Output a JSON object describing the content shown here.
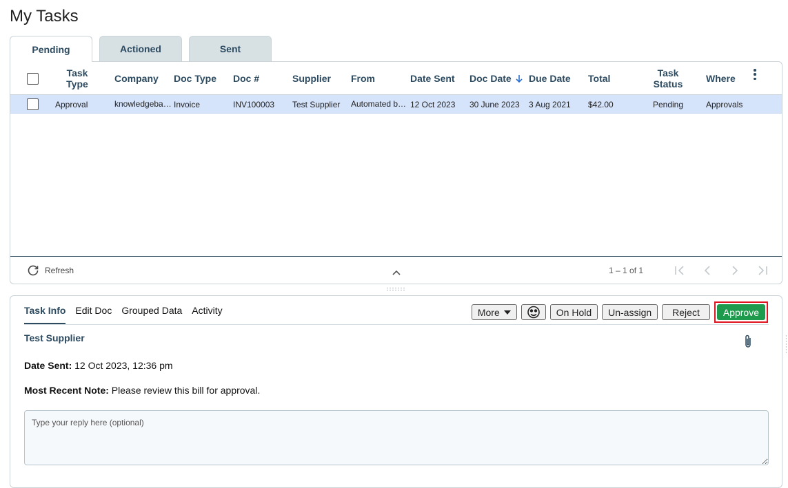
{
  "page": {
    "title": "My Tasks"
  },
  "tabs": [
    {
      "label": "Pending",
      "active": true
    },
    {
      "label": "Actioned",
      "active": false
    },
    {
      "label": "Sent",
      "active": false
    }
  ],
  "grid": {
    "columns": [
      "Task Type",
      "Company",
      "Doc Type",
      "Doc #",
      "Supplier",
      "From",
      "Date Sent",
      "Doc Date",
      "Due Date",
      "Total",
      "Task Status",
      "Where"
    ],
    "sort": {
      "column": "Doc Date",
      "direction": "desc"
    },
    "rows": [
      {
        "task_type": "Approval",
        "company": "knowledgeba…",
        "doc_type": "Invoice",
        "doc_no": "INV100003",
        "supplier": "Test Supplier",
        "from": "Automated b…",
        "date_sent": "12 Oct 2023",
        "doc_date": "30 June 2023",
        "due_date": "3 Aug 2021",
        "total": "$42.00",
        "task_status": "Pending",
        "where": "Approvals",
        "selected": true
      }
    ],
    "footer": {
      "refresh_label": "Refresh",
      "range": "1 – 1 of 1"
    }
  },
  "detail": {
    "tabs": [
      {
        "label": "Task Info",
        "active": true
      },
      {
        "label": "Edit Doc",
        "active": false
      },
      {
        "label": "Grouped Data",
        "active": false
      },
      {
        "label": "Activity",
        "active": false
      }
    ],
    "actions": {
      "more": "More",
      "on_hold": "On Hold",
      "unassign": "Un-assign",
      "reject": "Reject",
      "approve": "Approve"
    },
    "supplier_name": "Test Supplier",
    "date_sent_label": "Date Sent:",
    "date_sent_value": "12 Oct 2023, 12:36 pm",
    "note_label": "Most Recent Note:",
    "note_value": "Please review this bill for approval.",
    "reply_placeholder": "Type your reply here (optional)"
  },
  "colors": {
    "accent": "#2c4a60",
    "selected_row": "#d5e3fb",
    "approve": "#1e9a4c",
    "highlight_box": "#e0141e"
  },
  "icons": [
    "refresh-icon",
    "sort-arrow-down-icon",
    "kebab-menu-icon",
    "first-page-icon",
    "prev-page-icon",
    "next-page-icon",
    "last-page-icon",
    "chevron-up-icon",
    "chevron-down-icon",
    "user-face-icon",
    "paperclip-icon"
  ]
}
